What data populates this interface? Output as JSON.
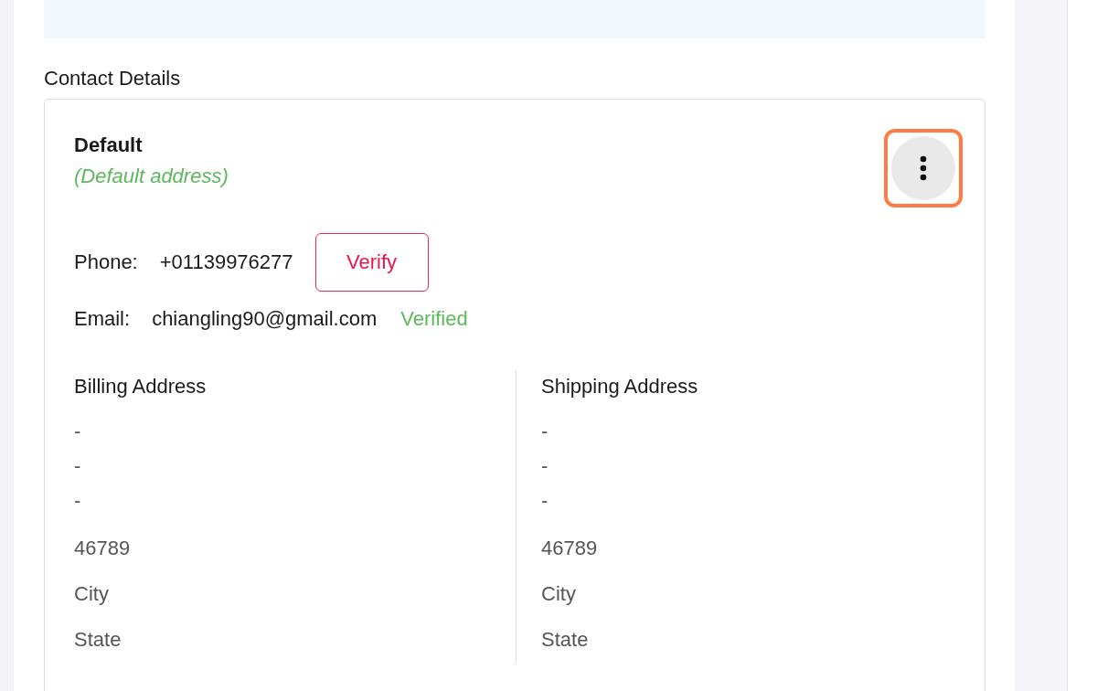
{
  "section_title": "Contact Details",
  "contact": {
    "name": "Default",
    "subtitle": "(Default address)",
    "menu_highlighted": true,
    "phone": {
      "label": "Phone:",
      "value": "+01139976277",
      "action": "Verify"
    },
    "email": {
      "label": "Email:",
      "value": "chiangling90@gmail.com",
      "status": "Verified"
    },
    "addresses": [
      {
        "title": "Billing Address",
        "street_lines": [
          "-",
          "-",
          "-"
        ],
        "lines": [
          "46789",
          "City",
          "State"
        ]
      },
      {
        "title": "Shipping Address",
        "street_lines": [
          "-",
          "-",
          "-"
        ],
        "lines": [
          "46789",
          "City",
          "State"
        ]
      }
    ]
  }
}
